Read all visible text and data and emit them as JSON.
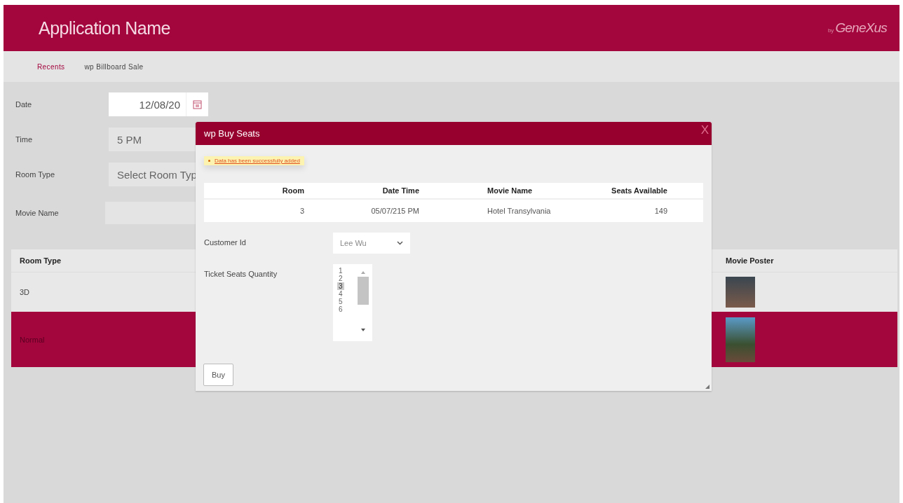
{
  "header": {
    "app_name": "Application Name",
    "brand_prefix": "by",
    "brand": "GeneXus"
  },
  "breadcrumbs": [
    {
      "label": "Recents",
      "selected": false
    },
    {
      "label": "wp Billboard Sale",
      "selected": true
    }
  ],
  "form": {
    "date": {
      "label": "Date",
      "value": "12/08/20"
    },
    "time": {
      "label": "Time",
      "value": "5 PM"
    },
    "room_type": {
      "label": "Room Type",
      "placeholder": "Select Room Typ"
    },
    "movie_name": {
      "label": "Movie Name"
    }
  },
  "grid": {
    "columns": [
      "Room Type",
      "Movie Poster"
    ],
    "rows": [
      {
        "room_type": "3D",
        "selected": false
      },
      {
        "room_type": "Normal",
        "selected": true
      }
    ]
  },
  "dialog": {
    "title": "wp Buy Seats",
    "close": "X",
    "message": "Data has been successfully added",
    "table": {
      "columns": [
        "Room",
        "Date Time",
        "Movie Name",
        "Seats Available"
      ],
      "rows": [
        [
          "3",
          "05/07/215 PM",
          "Hotel Transylvania",
          "149"
        ]
      ]
    },
    "customer": {
      "label": "Customer Id",
      "value": "Lee Wu"
    },
    "seats": {
      "label": "Ticket Seats Quantity",
      "options": [
        {
          "label": "1",
          "selected": false
        },
        {
          "label": "2",
          "selected": false
        },
        {
          "label": "3",
          "selected": true
        },
        {
          "label": "4",
          "selected": false
        },
        {
          "label": "5",
          "selected": false
        },
        {
          "label": "6",
          "selected": false
        }
      ]
    },
    "buy": "Buy"
  }
}
